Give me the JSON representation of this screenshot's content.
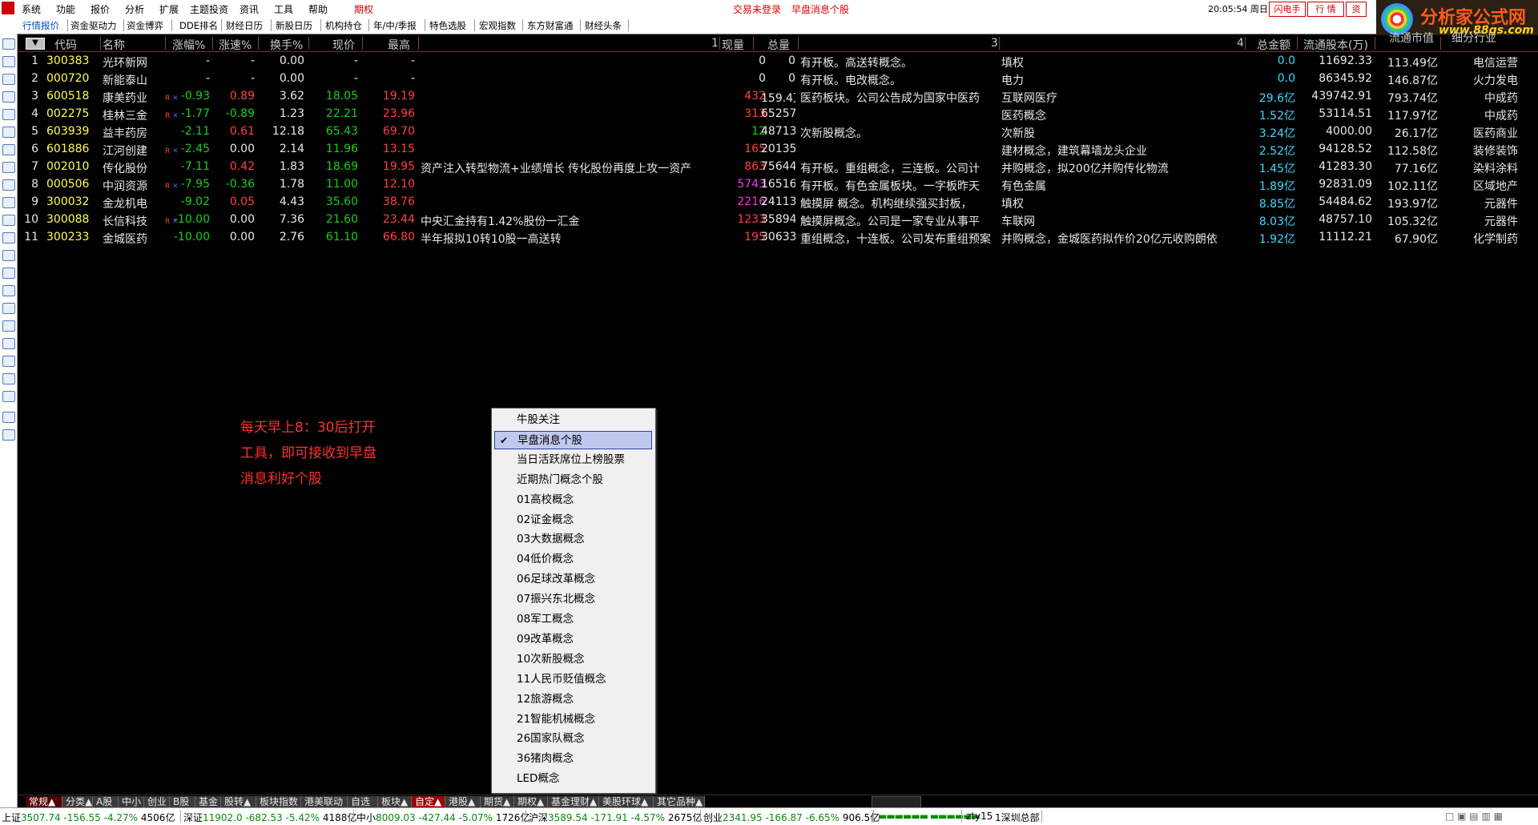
{
  "menubar": {
    "items": [
      "系统",
      "功能",
      "报价",
      "分析",
      "扩展",
      "主题投资",
      "资讯",
      "工具",
      "帮助",
      "期权"
    ],
    "status_trade": "交易未登录",
    "status_title": "早盘消息个股",
    "clock": "20:05:54",
    "weekday": "周日",
    "btn_flash": "闪电手",
    "btn_market": "行 情",
    "btn_info": "资",
    "logo_text": "分析家公式网",
    "logo_url": "www.88gs.com"
  },
  "toolbar2": {
    "tabs": [
      "行情报价",
      "资金驱动力",
      "资金博弈",
      "DDE排名",
      "财经日历",
      "新股日历",
      "机构持仓",
      "年/中/季报",
      "特色选股",
      "宏观指数",
      "东方财富通",
      "财经头条"
    ]
  },
  "table": {
    "sort_btn": "▼",
    "headers": {
      "code": "代码",
      "name": "名称",
      "change_pct": "涨幅%",
      "speed": "涨速%",
      "turnover": "换手%",
      "price": "现价",
      "high": "最高",
      "col1": "1",
      "vol_now": "现量",
      "vol_total": "总量",
      "col3": "3",
      "col4": "4",
      "amount": "总金额",
      "float_shares": "流通股本(万)",
      "float_mv": "流通市值",
      "industry": "细分行业"
    },
    "rows": [
      {
        "no": "1",
        "code": "300383",
        "name": "光环新网",
        "rx": "",
        "chg": "-",
        "spd": "-",
        "turn": "0.00",
        "price": "-",
        "high": "-",
        "c1": "",
        "vnow": "0",
        "vtot": "0",
        "c3": "有开板。高送转概念。",
        "c4": "填权",
        "amt": "0.0",
        "fshare": "11692.33",
        "fmv": "113.49亿",
        "ind": "电信运营"
      },
      {
        "no": "2",
        "code": "000720",
        "name": "新能泰山",
        "rx": "",
        "chg": "-",
        "spd": "-",
        "turn": "0.00",
        "price": "-",
        "high": "-",
        "c1": "",
        "vnow": "0",
        "vtot": "0",
        "c3": "有开板。电改概念。",
        "c4": "电力",
        "amt": "0.0",
        "fshare": "86345.92",
        "fmv": "146.87亿",
        "ind": "火力发电"
      },
      {
        "no": "3",
        "code": "600518",
        "name": "康美药业",
        "rx": "R",
        "chg": "-0.93",
        "spd": "0.89",
        "turn": "3.62",
        "price": "18.05",
        "high": "19.19",
        "c1": "",
        "vnow": "432",
        "vtot": "159.4万",
        "c3": "医药板块。公司公告成为国家中医药",
        "c4": "互联网医疗",
        "amt": "29.6亿",
        "fshare": "439742.91",
        "fmv": "793.74亿",
        "ind": "中成药"
      },
      {
        "no": "4",
        "code": "002275",
        "name": "桂林三金",
        "rx": "R",
        "chg": "-1.77",
        "spd": "-0.89",
        "turn": "1.23",
        "price": "22.21",
        "high": "23.96",
        "c1": "",
        "vnow": "313",
        "vtot": "65257",
        "c3": "",
        "c4": "医药概念",
        "amt": "1.52亿",
        "fshare": "53114.51",
        "fmv": "117.97亿",
        "ind": "中成药"
      },
      {
        "no": "5",
        "code": "603939",
        "name": "益丰药房",
        "rx": "",
        "chg": "-2.11",
        "spd": "0.61",
        "turn": "12.18",
        "price": "65.43",
        "high": "69.70",
        "c1": "",
        "vnow": "12",
        "vtot": "48713",
        "c3": "次新股概念。",
        "c4": "次新股",
        "amt": "3.24亿",
        "fshare": "4000.00",
        "fmv": "26.17亿",
        "ind": "医药商业"
      },
      {
        "no": "6",
        "code": "601886",
        "name": "江河创建",
        "rx": "R",
        "chg": "-2.45",
        "spd": "0.00",
        "turn": "2.14",
        "price": "11.96",
        "high": "13.15",
        "c1": "",
        "vnow": "165",
        "vtot": "201359",
        "c3": "",
        "c4": "建材概念，建筑幕墙龙头企业",
        "amt": "2.52亿",
        "fshare": "94128.52",
        "fmv": "112.58亿",
        "ind": "装修装饰"
      },
      {
        "no": "7",
        "code": "002010",
        "name": "传化股份",
        "rx": "",
        "chg": "-7.11",
        "spd": "0.42",
        "turn": "1.83",
        "price": "18.69",
        "high": "19.95",
        "c1": "资产注入转型物流+业绩增长 传化股份再度上攻一资产",
        "vnow": "863",
        "vtot": "75644",
        "c3": "有开板。重组概念，三连板。公司计",
        "c4": "并购概念，拟200亿并购传化物流",
        "amt": "1.45亿",
        "fshare": "41283.30",
        "fmv": "77.16亿",
        "ind": "染料涂料"
      },
      {
        "no": "8",
        "code": "000506",
        "name": "中润资源",
        "rx": "R",
        "chg": "-7.95",
        "spd": "-0.36",
        "turn": "1.78",
        "price": "11.00",
        "high": "12.10",
        "c1": "",
        "vnow": "5743",
        "vtot": "165166",
        "c3": "有开板。有色金属板块。一字板昨天",
        "c4": "有色金属",
        "amt": "1.89亿",
        "fshare": "92831.09",
        "fmv": "102.11亿",
        "ind": "区域地产"
      },
      {
        "no": "9",
        "code": "300032",
        "name": "金龙机电",
        "rx": "",
        "chg": "-9.02",
        "spd": "0.05",
        "turn": "4.43",
        "price": "35.60",
        "high": "38.76",
        "c1": "",
        "vnow": "2216",
        "vtot": "241137",
        "c3": "触摸屏 概念。机构继续强买封板，",
        "c4": "填权",
        "amt": "8.85亿",
        "fshare": "54484.62",
        "fmv": "193.97亿",
        "ind": "元器件"
      },
      {
        "no": "10",
        "code": "300088",
        "name": "长信科技",
        "rx": "R",
        "chg": "-10.00",
        "spd": "0.00",
        "turn": "7.36",
        "price": "21.60",
        "high": "23.44",
        "c1": "中央汇金持有1.42%股份一汇金",
        "vnow": "1233",
        "vtot": "358940",
        "c3": "触摸屏概念。公司是一家专业从事平",
        "c4": "车联网",
        "amt": "8.03亿",
        "fshare": "48757.10",
        "fmv": "105.32亿",
        "ind": "元器件"
      },
      {
        "no": "11",
        "code": "300233",
        "name": "金城医药",
        "rx": "",
        "chg": "-10.00",
        "spd": "0.00",
        "turn": "2.76",
        "price": "61.10",
        "high": "66.80",
        "c1": "半年报拟10转10股一高送转",
        "vnow": "195",
        "vtot": "30633",
        "c3": "重组概念，十连板。公司发布重组预案",
        "c4": "并购概念，金城医药拟作价20亿元收购朗依",
        "amt": "1.92亿",
        "fshare": "11112.21",
        "fmv": "67.90亿",
        "ind": "化学制药"
      }
    ]
  },
  "note": {
    "line1": "每天早上8：30后打开",
    "line2": "工具，即可接收到早盘",
    "line3": "消息利好个股"
  },
  "popup": {
    "items": [
      "牛股关注",
      "早盘消息个股",
      "当日活跃席位上榜股票",
      "近期热门概念个股",
      "01高校概念",
      "02证金概念",
      "03大数据概念",
      "04低价概念",
      "06足球改革概念",
      "07振兴东北概念",
      "08军工概念",
      "09改革概念",
      "10次新股概念",
      "11人民币贬值概念",
      "12旅游概念",
      "21智能机械概念",
      "26国家队概念",
      "36猪肉概念",
      "LED概念"
    ],
    "selected_index": 1,
    "check": "✔"
  },
  "tabbar": {
    "tabs": [
      "常规▲",
      "分类▲",
      "A股",
      "中小",
      "创业",
      "B股",
      "基金",
      "股转▲",
      "板块指数",
      "港美联动",
      "自选",
      "板块▲",
      "自定▲",
      "港股▲",
      "期货▲",
      "期权▲",
      "基金理财▲",
      "美股环球▲",
      "其它品种▲"
    ],
    "active": "自定▲"
  },
  "statusbar": {
    "sh_label": "上证",
    "sh_value": "3507.74",
    "sh_chg": "-156.55",
    "sh_pct": "-4.27%",
    "sh_amt": "4506亿",
    "sz_label": "深证",
    "sz_value": "11902.0",
    "sz_chg": "-682.53",
    "sz_pct": "-5.42%",
    "sz_amt": "4188亿",
    "zx_label": "中小",
    "zx_value": "8009.03",
    "zx_chg": "-427.44",
    "zx_pct": "-5.07%",
    "zx_amt": "1726亿",
    "hs_label": "沪深",
    "hs_value": "3589.54",
    "hs_chg": "-171.91",
    "hs_pct": "-4.57%",
    "hs_amt": "2675亿",
    "cy_label": "创业",
    "cy_value": "2341.95",
    "cy_chg": "-166.87",
    "cy_pct": "-6.65%",
    "cy_amt": "906.5亿",
    "user": "zty15",
    "server": "1深圳总部"
  },
  "colors": {
    "up": "#ff4040",
    "down": "#18d018",
    "code": "#ffff48",
    "cyan": "#3fd8ff",
    "magenta": "#e43ee4",
    "active_tab": "#a00000"
  }
}
